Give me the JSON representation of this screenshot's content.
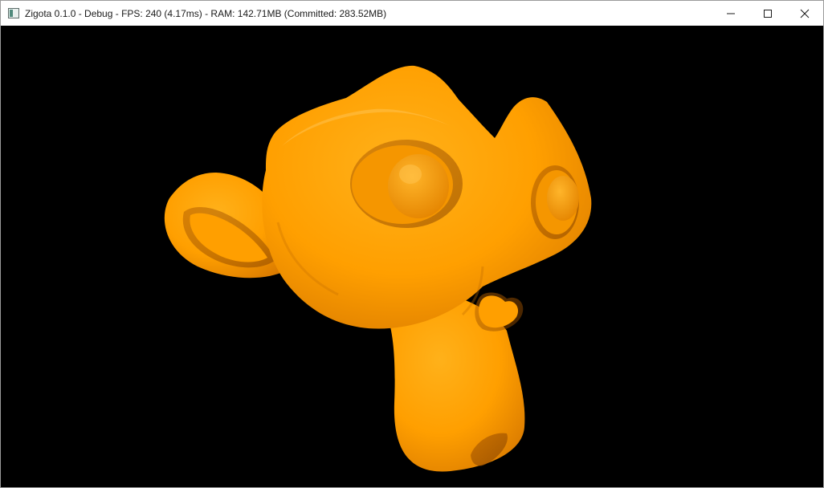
{
  "window": {
    "title": "Zigota 0.1.0 - Debug - FPS: 240 (4.17ms) - RAM: 142.71MB (Committed: 283.52MB)",
    "icon": "app-window-icon"
  },
  "controls": {
    "minimize_icon": "minimize-icon",
    "maximize_icon": "maximize-icon",
    "close_icon": "close-icon"
  },
  "viewport": {
    "background": "#000000",
    "model": "monkey-head-mesh",
    "model_color": "#ff9f00"
  }
}
